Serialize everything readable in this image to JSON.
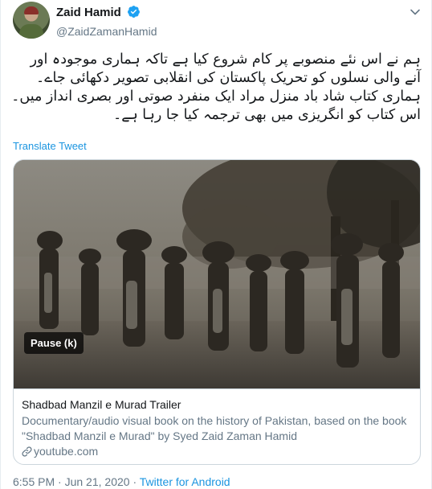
{
  "author": {
    "name": "Zaid Hamid",
    "handle": "@ZaidZamanHamid"
  },
  "tweet": {
    "lines": [
      "ہم نے اس نئے منصوبے پر کام شروع کیا ہے تاکہ ہماری موجودہ اور",
      "آنے والی نسلوں کو تحریک پاکستان کی انقلابی تصویر دکھائی جاے۔",
      "ہماری کتاب شاد باد منزل مراد ایک منفرد صوتی اور بصری انداز میں۔",
      "اس کتاب کو انگریزی میں بھی ترجمہ کیا جا رہا ہے۔"
    ],
    "translate_label": "Translate Tweet"
  },
  "card": {
    "pause_label": "Pause (k)",
    "title": "Shadbad Manzil e Murad Trailer",
    "description_line1": "Documentary/audio visual book on the history of Pakistan, based on the book",
    "description_line2": "\"Shadbad Manzil e Murad\" by Syed Zaid Zaman Hamid",
    "domain": "youtube.com"
  },
  "meta": {
    "time": "6:55 PM",
    "separator": "·",
    "date": "Jun 21, 2020",
    "source": "Twitter for Android"
  },
  "colors": {
    "link": "#1b95e0",
    "verified": "#1da1f2",
    "secondary_text": "#657786"
  },
  "icons": [
    "verified-badge-icon",
    "chevron-down-icon",
    "link-icon"
  ]
}
